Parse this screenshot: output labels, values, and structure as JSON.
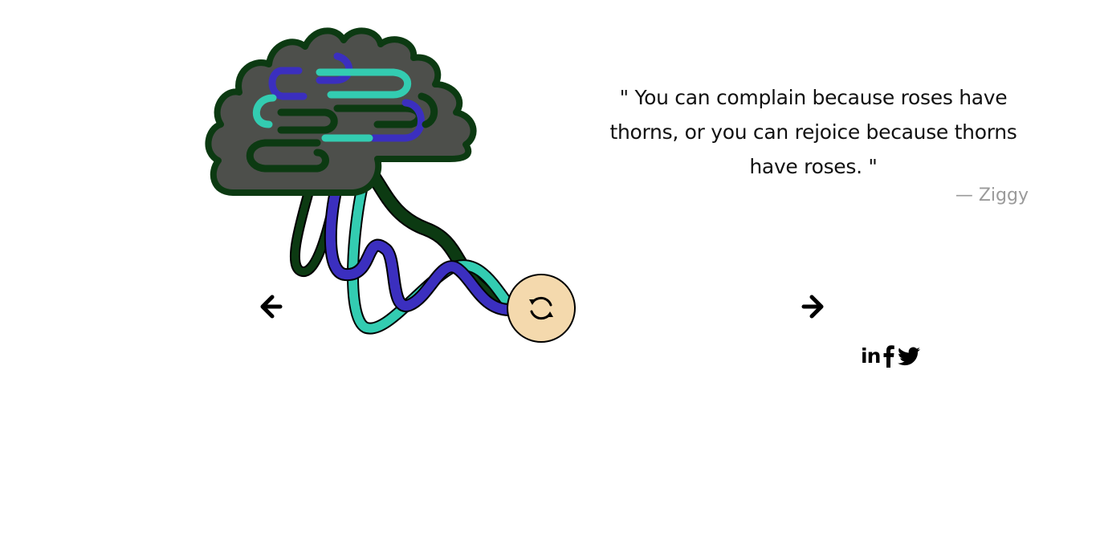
{
  "quote": {
    "text": "\" You can complain because roses have thorns, or you can rejoice because thorns have roses. \"",
    "author": "— Ziggy"
  },
  "controls": {
    "prev_icon": "arrow-left-icon",
    "next_icon": "arrow-right-icon",
    "refresh_icon": "refresh-icon"
  },
  "social": {
    "linkedin_label": "in",
    "linkedin_icon": "linkedin-icon",
    "facebook_icon": "facebook-icon",
    "twitter_icon": "twitter-icon"
  },
  "colors": {
    "brain_fill": "#4d4f4b",
    "brain_outline": "#0c3a12",
    "wire_dark_green": "#0c3a12",
    "wire_blue": "#3b2fbf",
    "wire_teal": "#33ccb1",
    "refresh_bg": "#f4d9ad",
    "author_gray": "#9a9a9a"
  }
}
